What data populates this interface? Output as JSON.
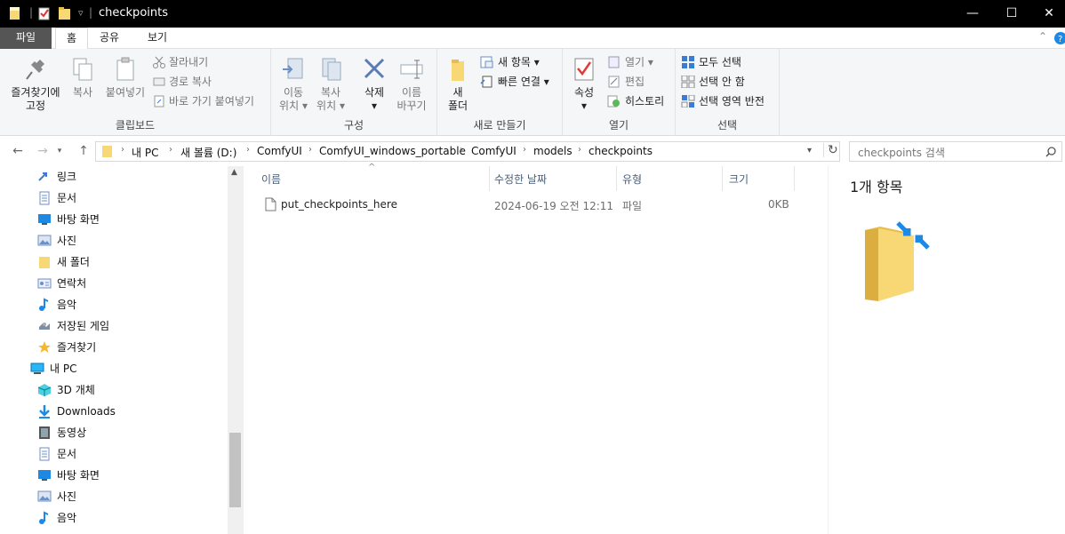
{
  "window": {
    "title": "checkpoints",
    "qat_dropdown": "▿",
    "minimize": "—",
    "maximize": "☐",
    "close": "✕"
  },
  "tabs": [
    {
      "label": "파일"
    },
    {
      "label": "홈"
    },
    {
      "label": "공유"
    },
    {
      "label": "보기"
    }
  ],
  "ribbon": {
    "clipboard": {
      "pin_line1": "즐겨찾기에",
      "pin_line2": "고정",
      "copy": "복사",
      "paste": "붙여넣기",
      "cut": "잘라내기",
      "copy_path": "경로 복사",
      "paste_shortcut": "바로 가기 붙여넣기",
      "label": "클립보드"
    },
    "organize": {
      "move_line1": "이동",
      "move_line2": "위치",
      "copyto_line1": "복사",
      "copyto_line2": "위치",
      "delete": "삭제",
      "rename_line1": "이름",
      "rename_line2": "바꾸기",
      "label": "구성"
    },
    "new": {
      "folder_line1": "새",
      "folder_line2": "폴더",
      "new_item": "새 항목",
      "easy_access": "빠른 연결",
      "label": "새로 만들기"
    },
    "open": {
      "properties": "속성",
      "open": "열기",
      "edit": "편집",
      "history": "히스토리",
      "label": "열기"
    },
    "select": {
      "select_all": "모두 선택",
      "select_none": "선택 안 함",
      "invert": "선택 영역 반전",
      "label": "선택"
    }
  },
  "address": {
    "crumbs": [
      "내 PC",
      "새 볼륨 (D:)",
      "ComfyUI",
      "ComfyUI_windows_portable",
      "ComfyUI",
      "models",
      "checkpoints"
    ],
    "search_placeholder": "checkpoints 검색"
  },
  "nav_items": [
    {
      "label": "링크",
      "icon": "link-icon"
    },
    {
      "label": "문서",
      "icon": "document-icon"
    },
    {
      "label": "바탕 화면",
      "icon": "desktop-icon"
    },
    {
      "label": "사진",
      "icon": "pictures-icon"
    },
    {
      "label": "새 폴더",
      "icon": "folder-icon"
    },
    {
      "label": "연락처",
      "icon": "contacts-icon"
    },
    {
      "label": "음악",
      "icon": "music-icon"
    },
    {
      "label": "저장된 게임",
      "icon": "saved-games-icon"
    },
    {
      "label": "즐겨찾기",
      "icon": "star-icon"
    },
    {
      "label": "내 PC",
      "icon": "computer-icon"
    },
    {
      "label": "3D 개체",
      "icon": "3d-objects-icon"
    },
    {
      "label": "Downloads",
      "icon": "downloads-icon"
    },
    {
      "label": "동영상",
      "icon": "videos-icon"
    },
    {
      "label": "문서",
      "icon": "document-icon"
    },
    {
      "label": "바탕 화면",
      "icon": "desktop-icon"
    },
    {
      "label": "사진",
      "icon": "pictures-icon"
    },
    {
      "label": "음악",
      "icon": "music-icon"
    }
  ],
  "columns": {
    "name": "이름",
    "date": "수정한 날짜",
    "type": "유형",
    "size": "크기"
  },
  "files": [
    {
      "name": "put_checkpoints_here",
      "date": "2024-06-19 오전 12:11",
      "type": "파일",
      "size": "0KB"
    }
  ],
  "preview": {
    "count": "1개 항목"
  },
  "colors": {
    "titlebar_bg": "#000000",
    "file_tab_bg": "#555555",
    "ribbon_bg": "#f5f6f7",
    "accent_blue": "#1e88e5",
    "folder_yellow": "#f8d775"
  }
}
